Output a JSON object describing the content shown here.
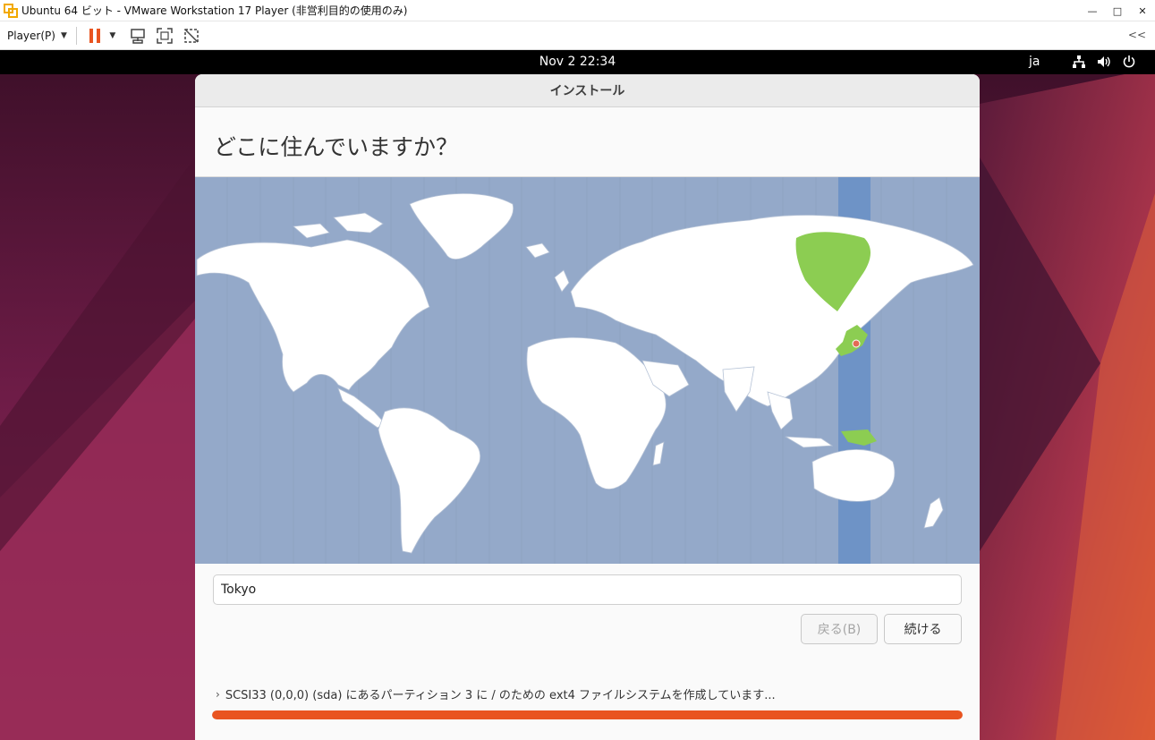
{
  "window": {
    "title": "Ubuntu 64 ビット - VMware Workstation 17 Player (非営利目的の使用のみ)",
    "controls": {
      "minimize": "—",
      "maximize": "□",
      "close": "✕"
    }
  },
  "toolbar": {
    "player_menu": "Player(P)",
    "collapse": "<<"
  },
  "guest_topbar": {
    "datetime": "Nov 2  22:34",
    "input_language": "ja"
  },
  "installer": {
    "window_title": "インストール",
    "heading": "どこに住んでいますか？",
    "timezone_input_value": "Tokyo",
    "back_button": "戻る(B)",
    "continue_button": "続ける",
    "status_text": "SCSI33 (0,0,0) (sda) にあるパーティション 3 に / のための ext4 ファイルシステムを作成しています...",
    "progress_fraction": 1.0
  },
  "colors": {
    "accent": "#e95420",
    "map_ocean": "#94a9c9",
    "map_selected_zone": "#6e93c6",
    "map_highlight_land": "#8ccd52",
    "map_land": "#ffffff"
  }
}
